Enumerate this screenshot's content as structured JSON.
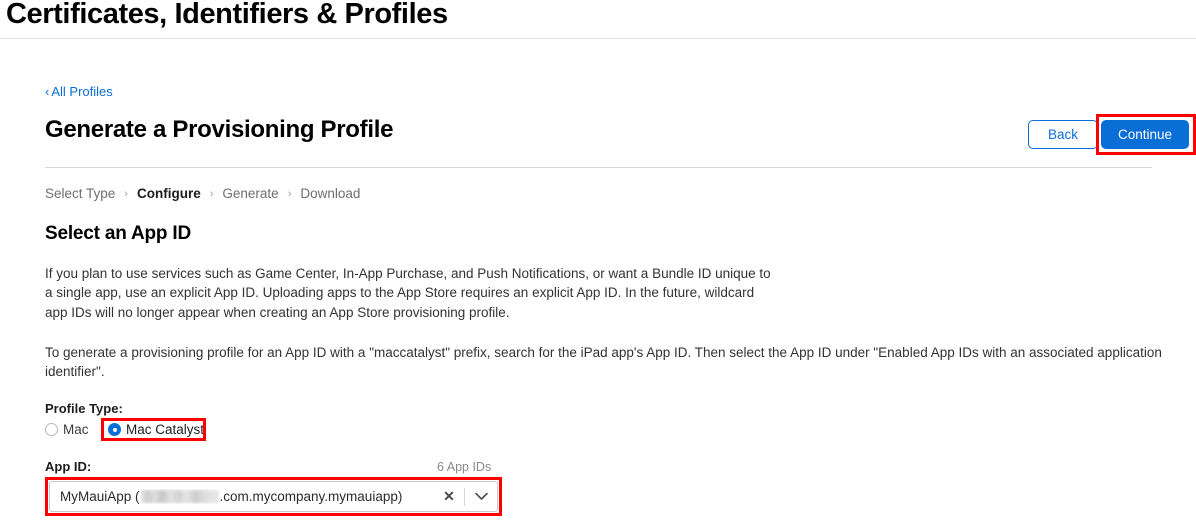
{
  "page": {
    "title": "Certificates, Identifiers & Profiles"
  },
  "breadcrumb": {
    "back_link": "All Profiles",
    "back_chevron": "‹"
  },
  "header": {
    "section_title": "Generate a Provisioning Profile",
    "back_button": "Back",
    "continue_button": "Continue"
  },
  "steps": {
    "separator": "›",
    "items": [
      {
        "label": "Select Type",
        "active": false
      },
      {
        "label": "Configure",
        "active": true
      },
      {
        "label": "Generate",
        "active": false
      },
      {
        "label": "Download",
        "active": false
      }
    ]
  },
  "main": {
    "heading": "Select an App ID",
    "paragraph_1": "If you plan to use services such as Game Center, In-App Purchase, and Push Notifications, or want a Bundle ID unique to a single app, use an explicit App ID. Uploading apps to the App Store requires an explicit App ID. In the future, wildcard app IDs will no longer appear when creating an App Store provisioning profile.",
    "paragraph_2": "To generate a provisioning profile for an App ID with a \"maccatalyst\" prefix, search for the iPad app's App ID. Then select the App ID under \"Enabled App IDs with an associated application identifier\"."
  },
  "profile_type": {
    "label": "Profile Type:",
    "options": [
      {
        "label": "Mac",
        "selected": false
      },
      {
        "label": "Mac Catalyst",
        "selected": true
      }
    ]
  },
  "app_id": {
    "label": "App ID:",
    "count": "6 App IDs",
    "value_prefix": "MyMauiApp (",
    "value_redacted": "",
    "value_suffix": ".com.mycompany.mymauiapp)",
    "clear_icon": "✕"
  },
  "colors": {
    "accent_blue": "#0a6ed7",
    "annotation_red": "#ff0000",
    "text_primary": "#1d1d1f",
    "text_muted": "#6e6e73"
  }
}
